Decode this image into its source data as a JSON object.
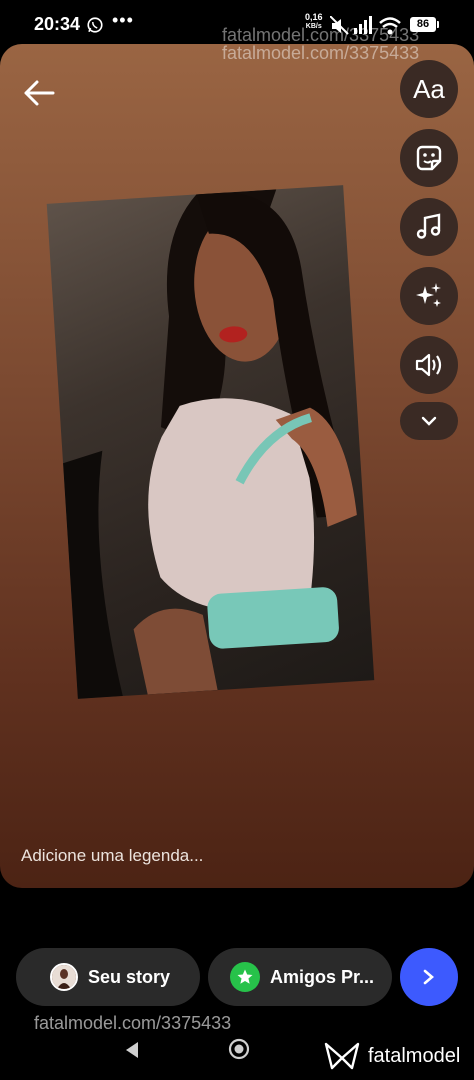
{
  "status": {
    "time": "20:34",
    "network_speed_value": "0,16",
    "network_speed_unit": "KB/s",
    "battery": "86"
  },
  "watermark": {
    "top_line1": "fatalmodel.com/3375433",
    "top_line2": "fatalmodel.com/3375433",
    "bottom": "fatalmodel.com/3375433",
    "brand_name": "fatalmodel"
  },
  "editor": {
    "text_tool_label": "Aa",
    "caption_placeholder": "Adicione uma legenda..."
  },
  "share": {
    "story_label": "Seu story",
    "friends_label": "Amigos Pr..."
  },
  "colors": {
    "accent": "#3d5afe",
    "friends_badge": "#27c24a",
    "pill_bg": "#2a2a2a"
  },
  "icons": [
    "whatsapp-icon",
    "more-dots-icon",
    "mute-icon",
    "signal-icon",
    "wifi-icon",
    "battery-icon",
    "back-arrow-icon",
    "sticker-icon",
    "music-icon",
    "effects-icon",
    "volume-icon",
    "chevron-down-icon",
    "star-icon",
    "arrow-right-icon",
    "nav-back-icon",
    "nav-home-icon",
    "fatalmodel-logo-icon"
  ]
}
